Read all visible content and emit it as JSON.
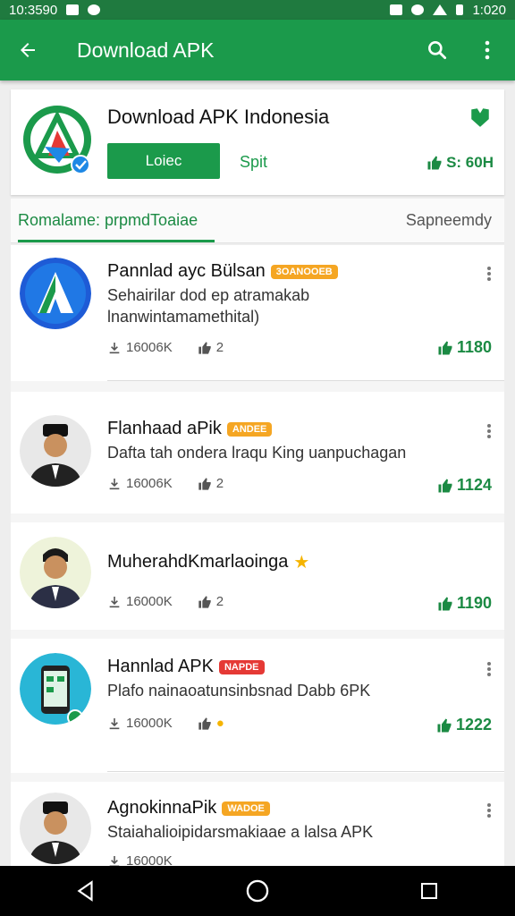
{
  "status": {
    "time": "10:3590",
    "clock_right": "1:020"
  },
  "appbar": {
    "title": "Download APK",
    "back_icon": "arrow-left-icon",
    "search_icon": "search-icon",
    "more_icon": "more-vert-icon"
  },
  "header": {
    "name": "Download APK Indonesia",
    "install_label": "Loiec",
    "split_label": "Spit",
    "rating": "S: 60H",
    "colors": {
      "brand": "#1b9a4b",
      "accent": "#1b8a43"
    }
  },
  "tabs": {
    "left": "Romalame: prpmdToaiae",
    "right": "Sapneemdy"
  },
  "items": [
    {
      "title": "Pannlad ayc Bülsan",
      "badge": "3OANOOEB",
      "desc1": "Sehairilar dod ep atramakab",
      "desc2": "lnanwintamamethital)",
      "downloads": "16006K",
      "likes": "2",
      "score": "1180"
    },
    {
      "title": "Flanhaad aPik",
      "badge": "ANDEE",
      "desc1": "Dafta tah ondera lraqu King uanpuchagan",
      "downloads": "16006K",
      "likes": "2",
      "score": "1124"
    },
    {
      "title": "MuherahdKmarlaoinga",
      "desc1": "",
      "downloads": "16000K",
      "likes": "2",
      "score": "1190"
    },
    {
      "title": "Hannlad APK",
      "badge": "NAPDE",
      "desc1": "Plafo nainaoatunsinbsnad Dabb 6PK",
      "downloads": "16000K",
      "likes": "",
      "score": "1222"
    },
    {
      "title": "AgnokinnaPik",
      "badge": "WADOE",
      "desc1": "Staiahalioipidarsmakiaae a lalsa APK",
      "downloads": "16000K",
      "likes": "",
      "score": ""
    }
  ]
}
